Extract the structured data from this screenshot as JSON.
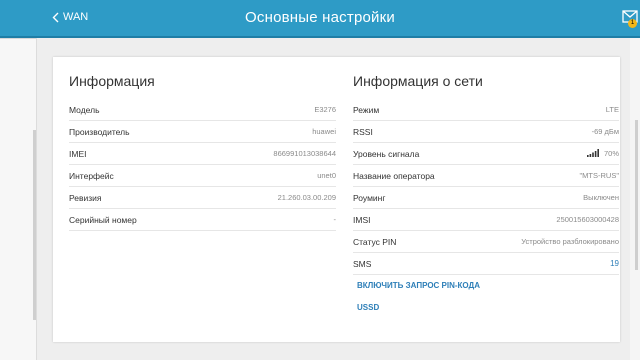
{
  "header": {
    "back_label": "WAN",
    "title": "Основные настройки",
    "mail_badge": "1"
  },
  "info": {
    "title": "Информация",
    "rows": [
      {
        "label": "Модель",
        "value": "E3276"
      },
      {
        "label": "Производитель",
        "value": "huawei"
      },
      {
        "label": "IMEI",
        "value": "866991013038644"
      },
      {
        "label": "Интерфейс",
        "value": "unet0"
      },
      {
        "label": "Ревизия",
        "value": "21.260.03.00.209"
      },
      {
        "label": "Серийный номер",
        "value": "-"
      }
    ]
  },
  "network": {
    "title": "Информация о сети",
    "rows": [
      {
        "label": "Режим",
        "value": "LTE"
      },
      {
        "label": "RSSI",
        "value": "-69 дБм"
      },
      {
        "label": "Уровень сигнала",
        "value": "70%"
      },
      {
        "label": "Название оператора",
        "value": "\"MTS-RUS\""
      },
      {
        "label": "Роуминг",
        "value": "Выключен"
      },
      {
        "label": "IMSI",
        "value": "250015603000428"
      },
      {
        "label": "Статус PIN",
        "value": "Устройство разблокировано"
      },
      {
        "label": "SMS",
        "value": "19"
      }
    ],
    "actions": {
      "pin_request": "ВКЛЮЧИТЬ ЗАПРОС PIN-КОДА",
      "ussd": "USSD"
    }
  },
  "colors": {
    "header_bg": "#2e9bc6",
    "link": "#2e7fb8",
    "badge": "#f2b619"
  },
  "icons": {
    "back": "chevron-left-icon",
    "mail": "envelope-icon",
    "signal": "signal-bars-icon"
  }
}
